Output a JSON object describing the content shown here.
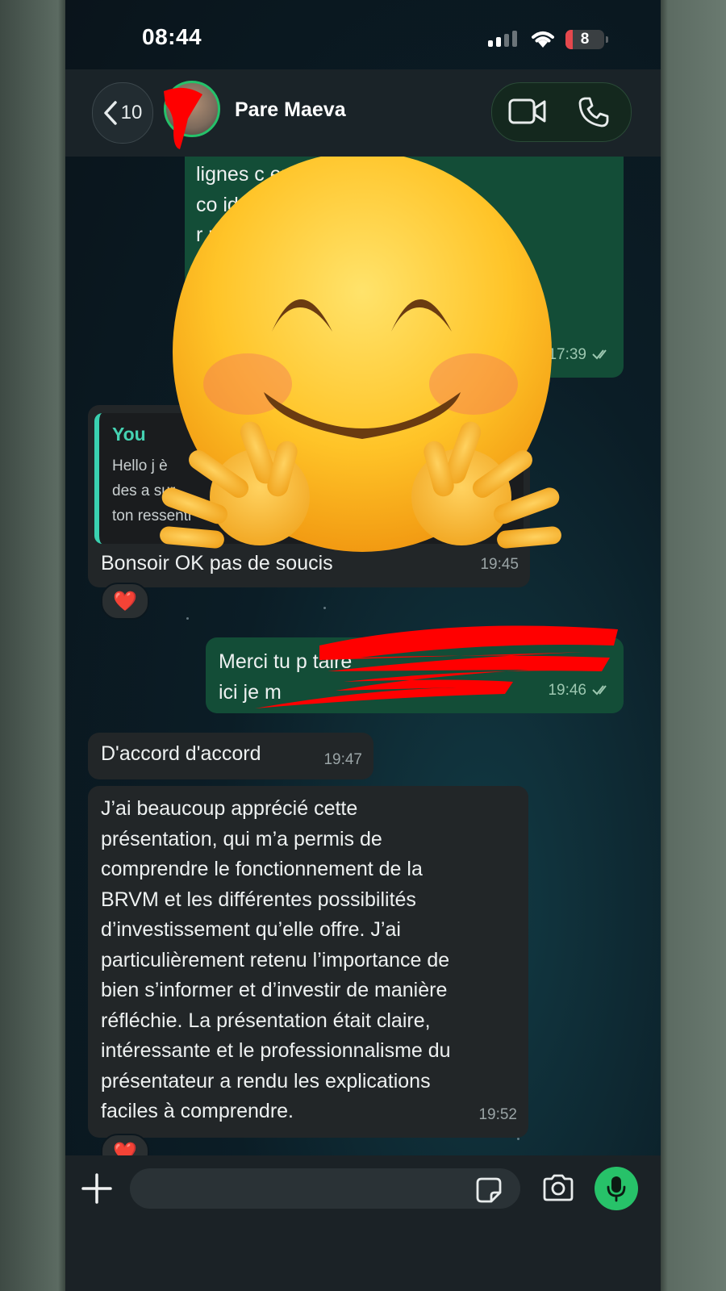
{
  "status_bar": {
    "time": "08:44",
    "battery_level": "8",
    "battery_fraction": 0.08,
    "signal_bars": 2,
    "icons": [
      "signal-icon",
      "wifi-icon",
      "battery-icon"
    ]
  },
  "header": {
    "back_count": "10",
    "contact_name": "Pare Maeva",
    "actions": [
      "video-call-icon",
      "phone-call-icon"
    ]
  },
  "messages": [
    {
      "direction": "outgoing",
      "text": "lignes c            enti de la\nco                        idée tu peux\nr                                pris sur\n                                 nalisme\n                                  n en\n                                  s. Ça",
      "time": "17:39",
      "status": "read"
    },
    {
      "direction": "incoming",
      "quote_author": "You",
      "quote_text": "Hello j       è\ndes a      sur\nton ressenti",
      "text": "Bonsoir OK pas de soucis",
      "time": "19:45",
      "reaction": "❤️"
    },
    {
      "direction": "outgoing",
      "text": "Merci tu p                          taire\nici je m",
      "time": "19:46",
      "status": "read"
    },
    {
      "direction": "incoming",
      "text": "D'accord d'accord",
      "time": "19:47"
    },
    {
      "direction": "incoming",
      "text": "J’ai beaucoup apprécié cette\nprésentation, qui m’a permis de\ncomprendre le fonctionnement de la\nBRVM et les différentes possibilités\nd’investissement qu’elle offre. J’ai\nparticulièrement retenu l’importance de\nbien s’informer et d’investir de manière\nréfléchie. La présentation était claire,\nintéressante et le professionnalisme du\nprésentateur a rendu les explications\nfaciles à comprendre.",
      "time": "19:52",
      "reaction": "❤️"
    }
  ],
  "composer": {
    "placeholder": "",
    "icons": [
      "plus-icon",
      "sticker-icon",
      "camera-icon",
      "microphone-icon"
    ]
  },
  "overlays": [
    "smiling-face-with-open-hands-emoji",
    "red-scribble-redaction"
  ],
  "colors": {
    "outgoing_bubble": "#134d37",
    "incoming_bubble": "#222628",
    "accent_green": "#27c269",
    "quote_accent": "#3ad1b0",
    "redaction_red": "#ff0000"
  }
}
